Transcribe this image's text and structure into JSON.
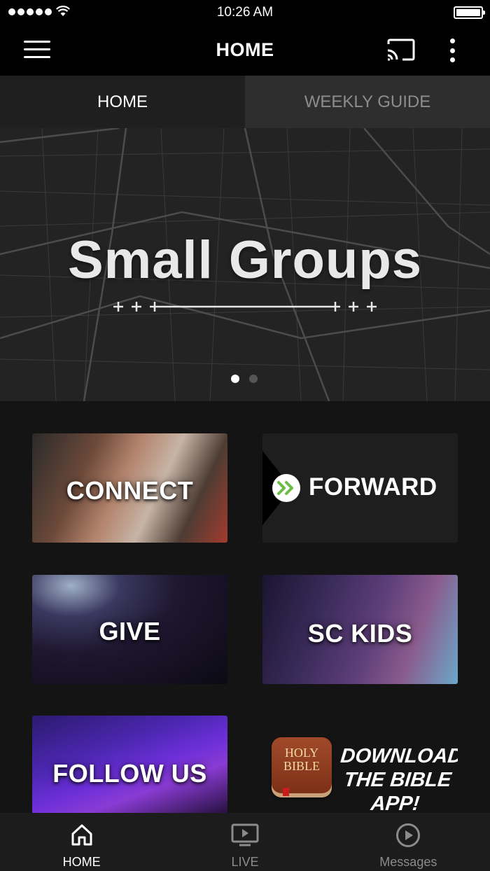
{
  "status_bar": {
    "time": "10:26 AM"
  },
  "app_bar": {
    "title": "HOME"
  },
  "tabs": [
    {
      "label": "HOME",
      "active": true
    },
    {
      "label": "WEEKLY GUIDE",
      "active": false
    }
  ],
  "banner": {
    "title": "Small Groups",
    "slide_count": 2,
    "active_slide": 1
  },
  "tiles": {
    "connect": "CONNECT",
    "forward": "FORWARD",
    "give": "GIVE",
    "kids": "SC KIDS",
    "follow": "FOLLOW US",
    "bible_book": "HOLY BIBLE",
    "bible_text": "DOWNLOAD THE BIBLE APP!"
  },
  "bottom_nav": [
    {
      "label": "HOME",
      "icon": "home-icon",
      "active": true
    },
    {
      "label": "LIVE",
      "icon": "tv-icon",
      "active": false
    },
    {
      "label": "Messages",
      "icon": "play-circle-icon",
      "active": false
    }
  ],
  "colors": {
    "accent_green": "#6cbd45",
    "background": "#141414",
    "active_text": "#ffffff",
    "inactive_text": "#8b8b8b"
  }
}
